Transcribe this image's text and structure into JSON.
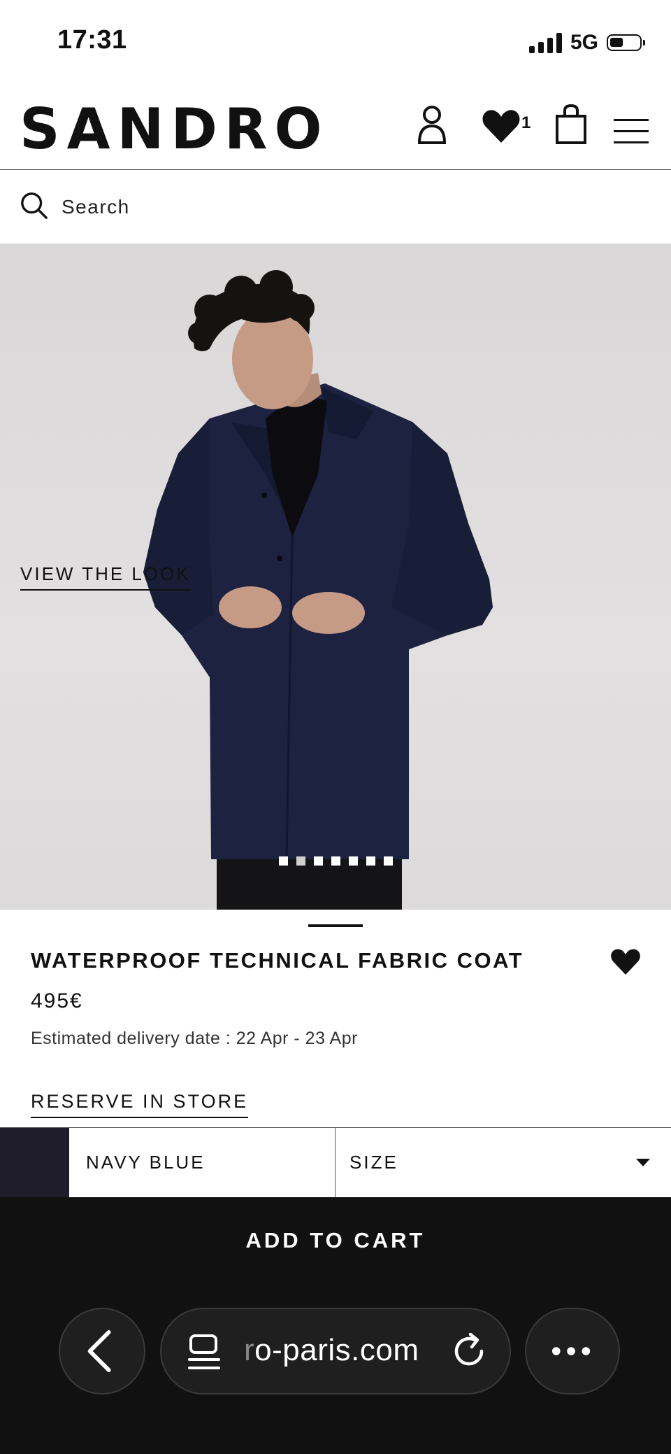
{
  "status_bar": {
    "time": "17:31",
    "network": "5G"
  },
  "header": {
    "logo": "SANDRO",
    "wishlist_count": "1"
  },
  "search": {
    "placeholder": "Search"
  },
  "gallery": {
    "view_the_look": "VIEW THE LOOK",
    "slide_count": 7,
    "active_slide": 2
  },
  "product": {
    "title": "WATERPROOF TECHNICAL FABRIC COAT",
    "price": "495€",
    "delivery": "Estimated delivery date : 22 Apr - 23 Apr",
    "reserve": "RESERVE IN STORE",
    "color_name": "NAVY BLUE",
    "color_swatch": "#201d2a",
    "size_label": "SIZE"
  },
  "cart": {
    "add_to_cart": "ADD TO CART"
  },
  "browser": {
    "url_faded": "r",
    "url": "o-paris.com"
  }
}
